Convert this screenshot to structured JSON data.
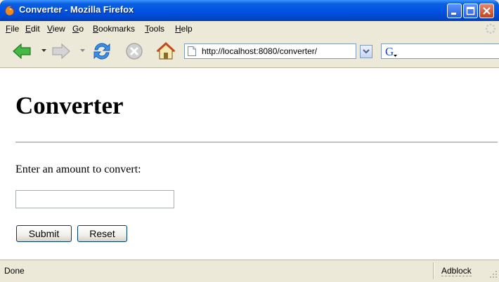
{
  "window": {
    "title": "Converter - Mozilla Firefox",
    "icon": "firefox-icon"
  },
  "menu": {
    "items": [
      {
        "label": "File",
        "access": "F"
      },
      {
        "label": "Edit",
        "access": "E"
      },
      {
        "label": "View",
        "access": "V"
      },
      {
        "label": "Go",
        "access": "G"
      },
      {
        "label": "Bookmarks",
        "access": "B"
      },
      {
        "label": "Tools",
        "access": "T"
      },
      {
        "label": "Help",
        "access": "H"
      }
    ]
  },
  "toolbar": {
    "buttons": [
      "back-icon",
      "forward-icon",
      "reload-icon",
      "stop-icon",
      "home-icon"
    ],
    "url": "http://localhost:8080/converter/",
    "search_engine_icon": "google-icon"
  },
  "page": {
    "heading": "Converter",
    "prompt": "Enter an amount to convert:",
    "amount_value": "",
    "submit_label": "Submit",
    "reset_label": "Reset"
  },
  "status": {
    "text": "Done",
    "adblock_label": "Adblock"
  },
  "colors": {
    "titlebar": "#0054e3",
    "chrome": "#ece9d8",
    "back_arrow": "#3aa83a"
  }
}
